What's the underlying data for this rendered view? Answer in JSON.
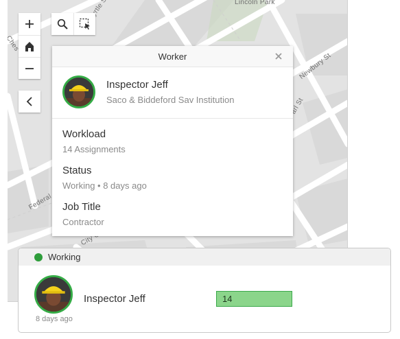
{
  "map": {
    "labels": {
      "lincoln_park": "Lincoln Park",
      "myrtle_st": "Myrtle St",
      "newbury_st": "Newbury St",
      "federal": "Federal",
      "city_c": "City C",
      "ches": "Ches",
      "earl_st": "arl St"
    },
    "controls": {
      "zoom_in": "zoom-in-icon",
      "home": "home-icon",
      "zoom_out": "zoom-out-icon",
      "collapse": "chevron-left-icon",
      "search": "search-icon",
      "select": "select-icon"
    }
  },
  "popup": {
    "title": "Worker",
    "worker": {
      "name": "Inspector Jeff",
      "organization": "Saco & Biddeford Sav Institution"
    },
    "fields": [
      {
        "label": "Workload",
        "value": "14 Assignments"
      },
      {
        "label": "Status",
        "value": "Working • 8 days ago"
      },
      {
        "label": "Job Title",
        "value": "Contractor"
      }
    ]
  },
  "card": {
    "status": "Working",
    "name": "Inspector Jeff",
    "time": "8 days ago",
    "count": "14"
  },
  "colors": {
    "status_green": "#2e9d3b",
    "avatar_ring": "#35ac46",
    "count_fill": "#8bd58b"
  }
}
